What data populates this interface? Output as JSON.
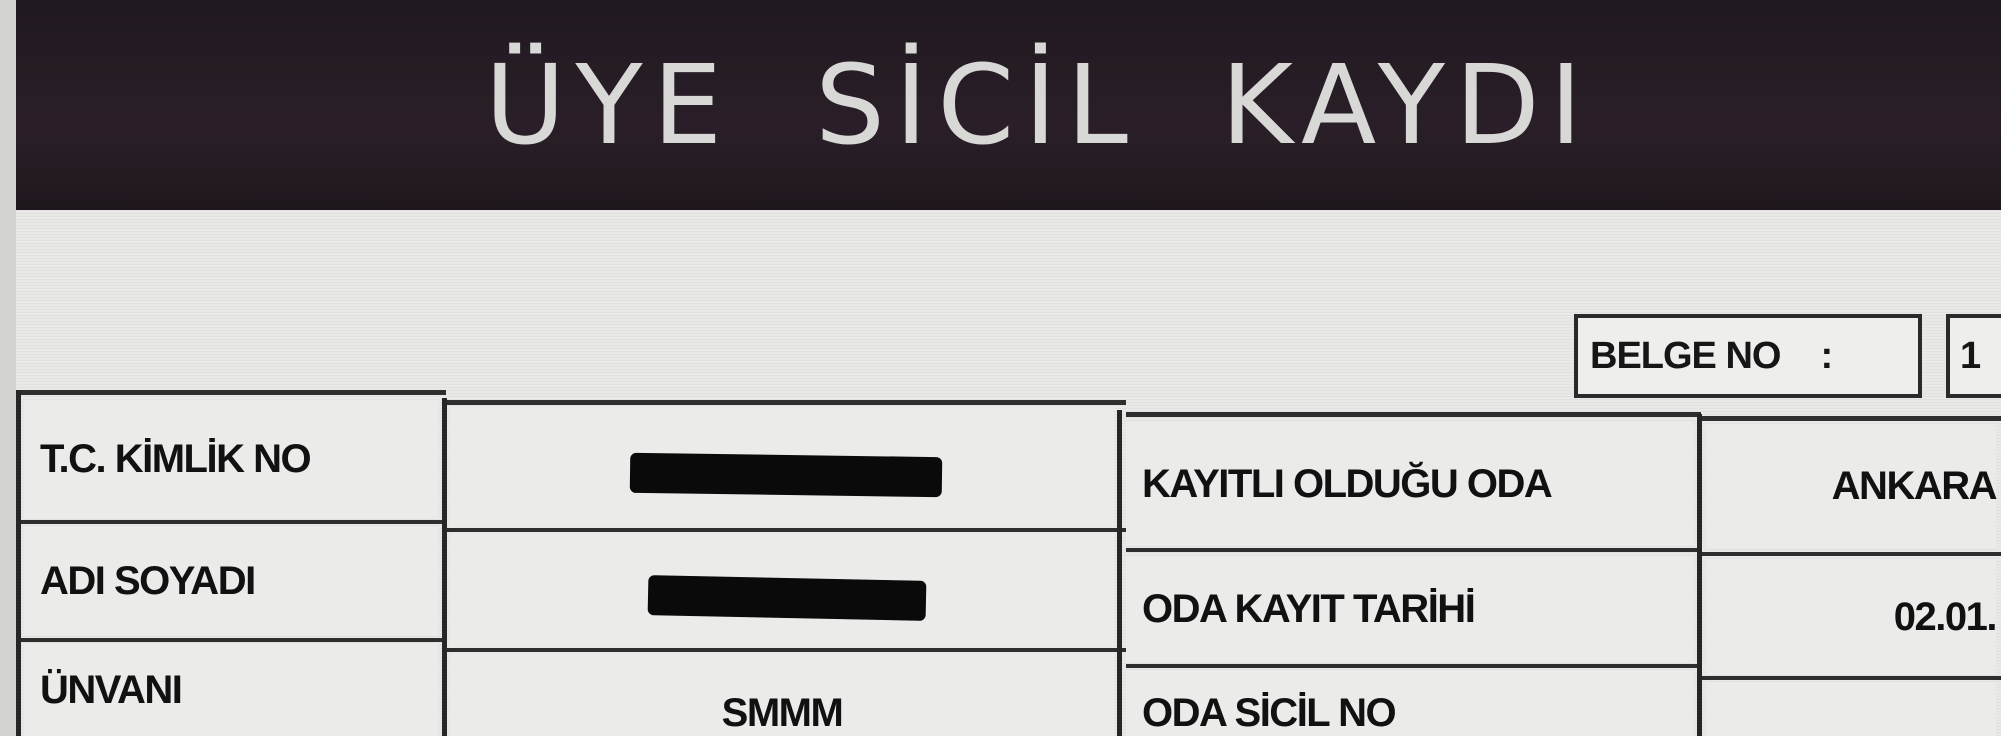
{
  "header": {
    "title": "ÜYE SİCİL KAYDI"
  },
  "document": {
    "belge_no_label": "BELGE NO",
    "belge_no_colon": ":",
    "belge_no_value": "1"
  },
  "rows": [
    {
      "left_label": "T.C. KİMLİK NO",
      "left_value": "",
      "right_label": "KAYITLI OLDUĞU ODA",
      "right_value": "ANKARA"
    },
    {
      "left_label": "ADI SOYADI",
      "left_value": "",
      "right_label": "ODA KAYIT TARİHİ",
      "right_value": "02.01."
    },
    {
      "left_label": "ÜNVANI",
      "left_value": "SMMM",
      "right_label": "ODA SİCİL NO",
      "right_value": ""
    }
  ],
  "colors": {
    "header_bg": "#241b23",
    "header_text": "#d8d8d6",
    "page_bg": "#e6e6e4",
    "border": "#262626"
  }
}
